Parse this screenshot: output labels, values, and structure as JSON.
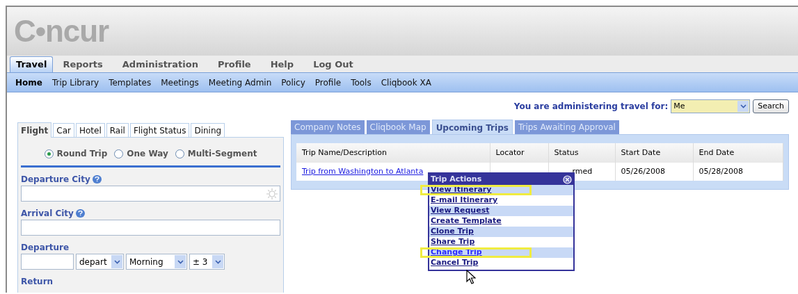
{
  "logo": {
    "text": "C•ncur"
  },
  "main_tabs": [
    {
      "label": "Travel",
      "selected": true
    },
    {
      "label": "Reports",
      "selected": false
    },
    {
      "label": "Administration",
      "selected": false
    },
    {
      "label": "Profile",
      "selected": false
    },
    {
      "label": "Help",
      "selected": false
    },
    {
      "label": "Log Out",
      "selected": false
    }
  ],
  "sub_nav": [
    {
      "label": "Home",
      "selected": true
    },
    {
      "label": "Trip Library",
      "selected": false
    },
    {
      "label": "Templates",
      "selected": false
    },
    {
      "label": "Meetings",
      "selected": false
    },
    {
      "label": "Meeting Admin",
      "selected": false
    },
    {
      "label": "Policy",
      "selected": false
    },
    {
      "label": "Profile",
      "selected": false
    },
    {
      "label": "Tools",
      "selected": false
    },
    {
      "label": "Cliqbook XA",
      "selected": false
    }
  ],
  "booking": {
    "tabs": [
      {
        "label": "Flight",
        "selected": true
      },
      {
        "label": "Car",
        "selected": false
      },
      {
        "label": "Hotel",
        "selected": false
      },
      {
        "label": "Rail",
        "selected": false
      },
      {
        "label": "Flight Status",
        "selected": false
      },
      {
        "label": "Dining",
        "selected": false
      }
    ],
    "trip_types": [
      {
        "label": "Round Trip",
        "selected": true
      },
      {
        "label": "One Way",
        "selected": false
      },
      {
        "label": "Multi-Segment",
        "selected": false
      }
    ],
    "departure_city": {
      "label": "Departure City"
    },
    "arrival_city": {
      "label": "Arrival City"
    },
    "departure": {
      "label": "Departure",
      "depart_select": "depart",
      "time_select": "Morning",
      "range_select": "± 3"
    },
    "return": {
      "label": "Return"
    }
  },
  "admin": {
    "label": "You are administering travel for:",
    "value": "Me",
    "search_button": "Search"
  },
  "trip_tabs": [
    {
      "label": "Company Notes",
      "selected": false
    },
    {
      "label": "Cliqbook Map",
      "selected": false
    },
    {
      "label": "Upcoming Trips",
      "selected": true
    },
    {
      "label": "Trips Awaiting Approval",
      "selected": false
    }
  ],
  "table": {
    "columns": [
      "Trip Name/Description",
      "Locator",
      "Status",
      "Start Date",
      "End Date"
    ],
    "rows": [
      {
        "trip": "Trip from Washington to Atlanta",
        "locator": "",
        "status": "rmed",
        "start": "05/26/2008",
        "end": "05/28/2008"
      }
    ]
  },
  "trip_actions": {
    "title": "Trip Actions",
    "items": [
      {
        "label": "View Itinerary",
        "highlighted": true
      },
      {
        "label": "E-mail Itinerary",
        "highlighted": false
      },
      {
        "label": "View Request",
        "highlighted": false
      },
      {
        "label": "Create Template",
        "highlighted": false
      },
      {
        "label": "Clone Trip",
        "highlighted": false
      },
      {
        "label": "Share Trip",
        "highlighted": false
      },
      {
        "label": "Change Trip",
        "highlighted": true
      },
      {
        "label": "Cancel Trip",
        "highlighted": false
      }
    ]
  }
}
